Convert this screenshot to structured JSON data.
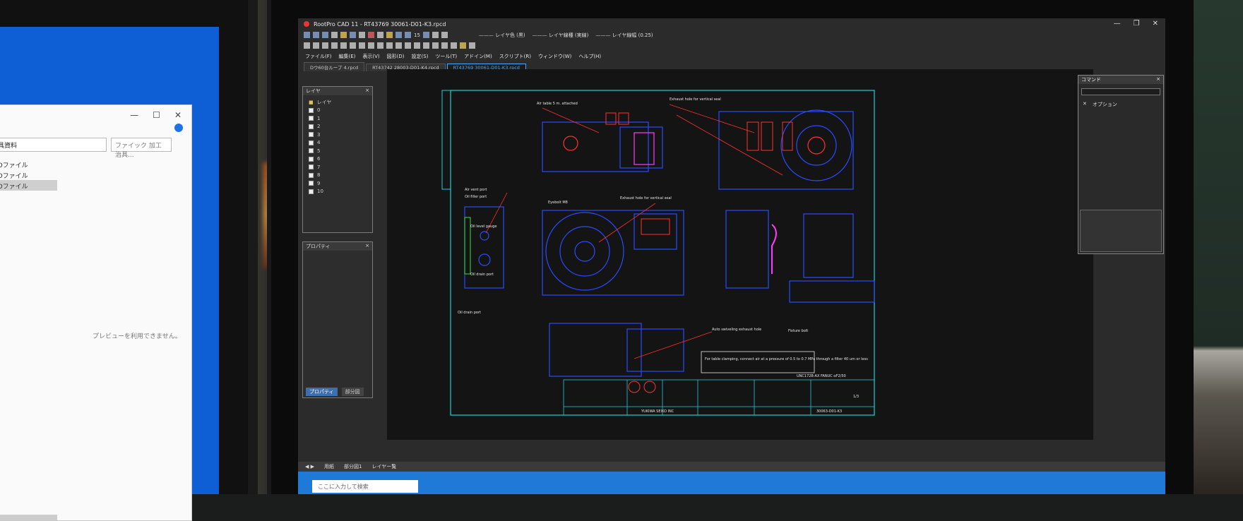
{
  "explorer": {
    "address": "工具資料",
    "search_placeholder": "ファイック 加工治具...",
    "items": [
      "PCDファイル",
      "PCDファイル",
      "PCDファイル"
    ],
    "preview_text": "プレビューを利用できません。"
  },
  "cad": {
    "window_title": "RootPro CAD 11 - RT43769 30061-D01-K3.rpcd",
    "menu": [
      "ファイル(F)",
      "編集(E)",
      "表示(V)",
      "図形(D)",
      "設定(S)",
      "ツール(T)",
      "アドイン(M)",
      "スクリプト(R)",
      "ウィンドウ(W)",
      "ヘルプ(H)"
    ],
    "tabs": [
      "Dウ60台ループ 4.rpcd",
      "RT43742 28003-D01-K4.rpcd",
      "RT43769 30061-D01-K3.rpcd"
    ],
    "toolbar_combos": [
      "レイヤ色 (黒)",
      "レイヤ線種 (実線)",
      "レイヤ線幅 (0.25)"
    ],
    "toolbar_scale": "15",
    "layer_panel_title": "レイヤ",
    "layer_root": "レイヤ",
    "layers": [
      "0",
      "1",
      "2",
      "3",
      "4",
      "5",
      "6",
      "7",
      "8",
      "9",
      "10"
    ],
    "property_panel_title": "プロパティ",
    "property_tabs": [
      "プロパティ",
      "部分図"
    ],
    "command_panel_title": "コマンド",
    "command_option": "オプション",
    "bottom_tabs": [
      "用紙",
      "部分図1",
      "レイヤー覧"
    ],
    "taskbar_search": "ここに入力して検索"
  },
  "drawing": {
    "notes": [
      "Air table 5 m. attached",
      "Exhaust hole for vertical seal",
      "Exhaust hole for vertical seal",
      "Air vent port",
      "Oil filler port",
      "Oil level gauge",
      "Oil drain port",
      "Oil drain port",
      "Eyebolt M8",
      "Fixture bolt",
      "Auto swiveling exhaust hole",
      "For table clamping, connect air at a pressure of 0.5 to 0.7 MPa through a filter 40 um or less"
    ],
    "title_block": {
      "company": "YUKIWA SEIKO INC",
      "drawing_no": "30063-D01-K3",
      "sheet": "1/3",
      "model": "UNC172B-AX FANUC αF2/50"
    }
  }
}
